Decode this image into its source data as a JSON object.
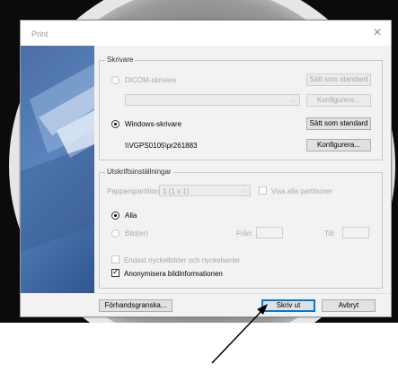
{
  "window": {
    "title": "Print",
    "close_glyph": "✕"
  },
  "printer_group": {
    "label": "Skrivare",
    "dicom_label": "DICOM-skrivare",
    "set_default_label": "Sätt som standard",
    "configure_label": "Konfigurera...",
    "windows_label": "Windows-skrivare",
    "windows_path": "\\\\VGPS0105\\pr261883"
  },
  "settings_group": {
    "label": "Utskriftsinställningar",
    "partition_label": "Papperspartition:",
    "partition_value": "1 (1 x 1)",
    "show_all_partitions_label": "Visa alla partitioner",
    "all_label": "Alla",
    "images_label": "Bild(er)",
    "from_label": "Från:",
    "to_label": "Till:",
    "key_images_label": "Endast nyckelbilder och nyckelserier",
    "anonymize_label": "Anonymisera bildinformationen"
  },
  "footer": {
    "preview_label": "Förhandsgranska...",
    "print_label": "Skriv ut",
    "cancel_label": "Avbryt"
  },
  "colors": {
    "accent": "#0078d7",
    "sidebar": "#4a6fa5"
  }
}
